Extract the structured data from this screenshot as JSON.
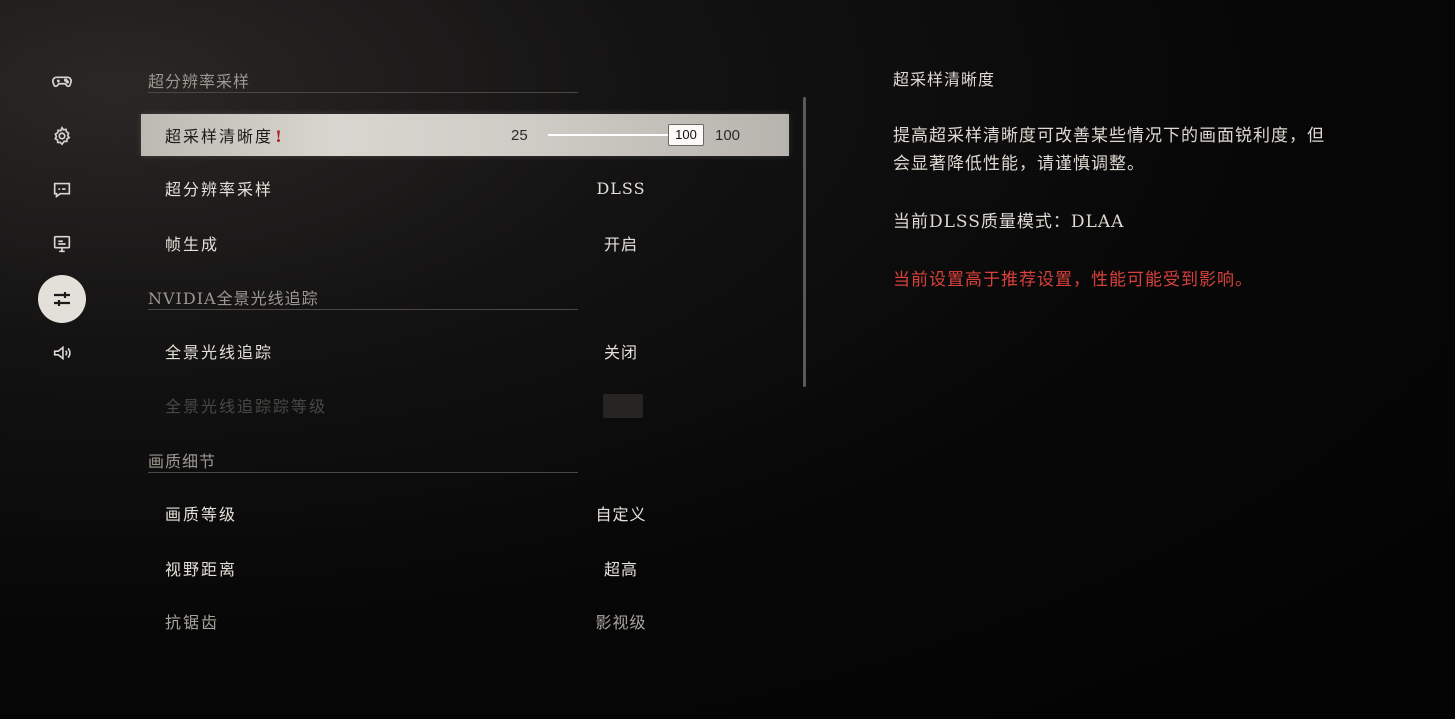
{
  "sidebar": {
    "icons": [
      {
        "name": "gamepad-icon",
        "active": false
      },
      {
        "name": "gear-icon",
        "active": false
      },
      {
        "name": "subtitles-icon",
        "active": false
      },
      {
        "name": "monitor-icon",
        "active": false
      },
      {
        "name": "graphics-sliders-icon",
        "active": true
      },
      {
        "name": "speaker-icon",
        "active": false
      }
    ]
  },
  "sections": {
    "upscaling": "超分辨率采样",
    "raytracing": "NVIDIA全景光线追踪",
    "quality": "画质细节"
  },
  "rows": {
    "sharpness": {
      "label": "超采样清晰度",
      "warn": "!",
      "min": "25",
      "thumb": "100",
      "max": "100",
      "fill_fraction": 1.0
    },
    "upscale": {
      "label": "超分辨率采样",
      "value": "DLSS"
    },
    "framegen": {
      "label": "帧生成",
      "value": "开启"
    },
    "pathtracing": {
      "label": "全景光线追踪",
      "value": "关闭"
    },
    "pathtracing_level": {
      "label": "全景光线追踪踪等级"
    },
    "quality_level": {
      "label": "画质等级",
      "value": "自定义"
    },
    "view_distance": {
      "label": "视野距离",
      "value": "超高"
    },
    "antialias": {
      "label": "抗锯齿",
      "value": "影视级"
    }
  },
  "description": {
    "title": "超采样清晰度",
    "body": "提高超采样清晰度可改善某些情况下的画面锐利度，但会显著降低性能，请谨慎调整。",
    "mode": "当前DLSS质量模式：DLAA",
    "warning": "当前设置高于推荐设置，性能可能受到影响。"
  },
  "colors": {
    "warning": "#d8413c",
    "accent_warn": "#b01f1f"
  }
}
